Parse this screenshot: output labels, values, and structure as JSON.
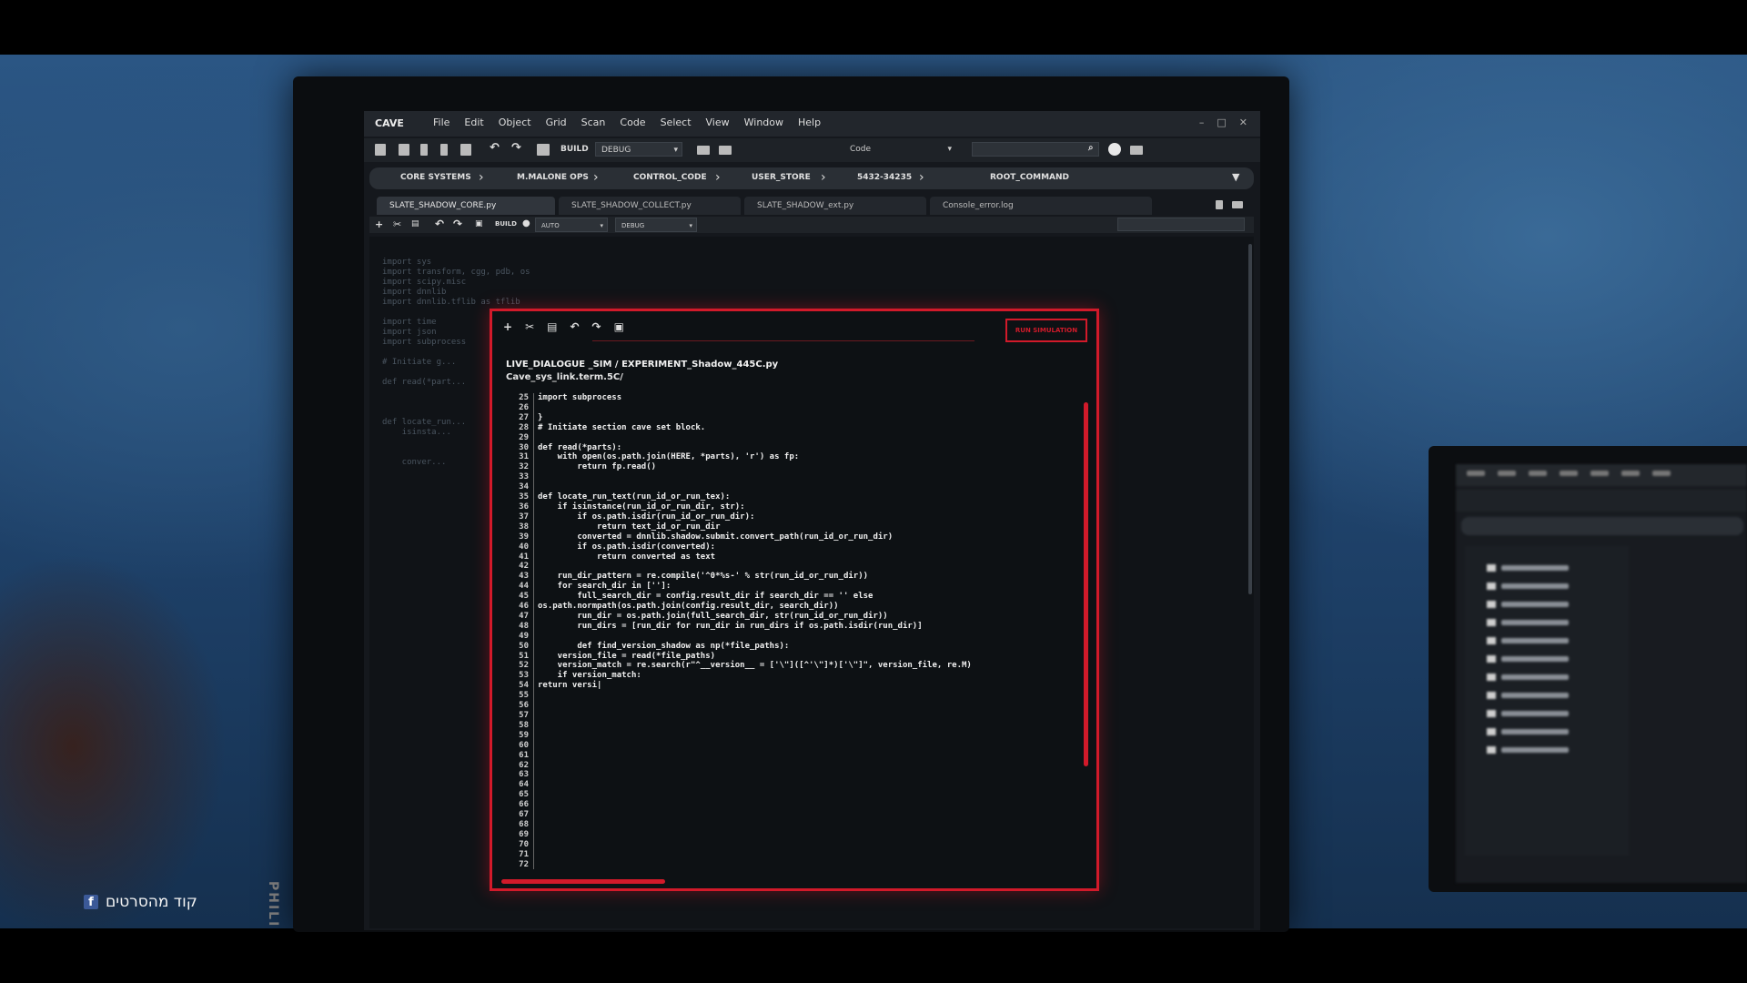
{
  "app": {
    "name": "CAVE",
    "menu": [
      "File",
      "Edit",
      "Object",
      "Grid",
      "Scan",
      "Code",
      "Select",
      "View",
      "Window",
      "Help"
    ],
    "window_controls": [
      "–",
      "□",
      "✕"
    ]
  },
  "toolbar": {
    "build_label": "BUILD",
    "config_value": "DEBUG",
    "mode_value": "Code",
    "search_placeholder": ""
  },
  "breadcrumbs": [
    "CORE SYSTEMS",
    "M.MALONE OPS",
    "CONTROL_CODE",
    "USER_STORE",
    "5432-34235",
    "ROOT_COMMAND"
  ],
  "tabs": [
    "SLATE_SHADOW_CORE.py",
    "SLATE_SHADOW_COLLECT.py",
    "SLATE_SHADOW_ext.py",
    "Console_error.log"
  ],
  "subbar": {
    "build_label": "BUILD",
    "dd1": "AUTO",
    "dd2": "DEBUG"
  },
  "background_code": "import sys\nimport transform, cgg, pdb, os\nimport scipy.misc\nimport dnnlib\nimport dnnlib.tflib as tflib\n\nimport time\nimport json\nimport subprocess\n\n# Initiate g...\n\ndef read(*part...\n\n\n\ndef locate_run...\n    isinsta...\n\n\n    conver...",
  "overlay": {
    "badge": "RUN SIMULATION",
    "path": "LIVE_DIALOGUE _SIM /  EXPERIMENT_Shadow_445C.py",
    "subpath": "Cave_sys_link.term.5C/",
    "line_start": 25,
    "line_end": 72,
    "code": "import subprocess\n\n}\n# Initiate section cave set block.\n\ndef read(*parts):\n    with open(os.path.join(HERE, *parts), 'r') as fp:\n        return fp.read()\n\n\ndef locate_run_text(run_id_or_run_tex):\n    if isinstance(run_id_or_run_dir, str):\n        if os.path.isdir(run_id_or_run_dir):\n            return text_id_or_run_dir\n        converted = dnnlib.shadow.submit.convert_path(run_id_or_run_dir)\n        if os.path.isdir(converted):\n            return converted as text\n\n    run_dir_pattern = re.compile('^0*%s-' % str(run_id_or_run_dir))\n    for search_dir in ['']:\n        full_search_dir = config.result_dir if search_dir == '' else\nos.path.normpath(os.path.join(config.result_dir, search_dir))\n        run_dir = os.path.join(full_search_dir, str(run_id_or_run_dir))\n        run_dirs = [run_dir for run_dir in run_dirs if os.path.isdir(run_dir)]\n\n        def find_version_shadow as np(*file_paths):\n    version_file = read(*file_paths)\n    version_match = re.search(r\"^__version__ = ['\\\"]([^'\\\"]*)['\\\"]\", version_file, re.M)\n    if version_match:\nreturn versi|"
  },
  "watermark": {
    "icon": "facebook-icon",
    "text": "קוד מהסרטים"
  },
  "colors": {
    "accent_red": "#d11a2a",
    "background_blue": "#2b5684"
  }
}
